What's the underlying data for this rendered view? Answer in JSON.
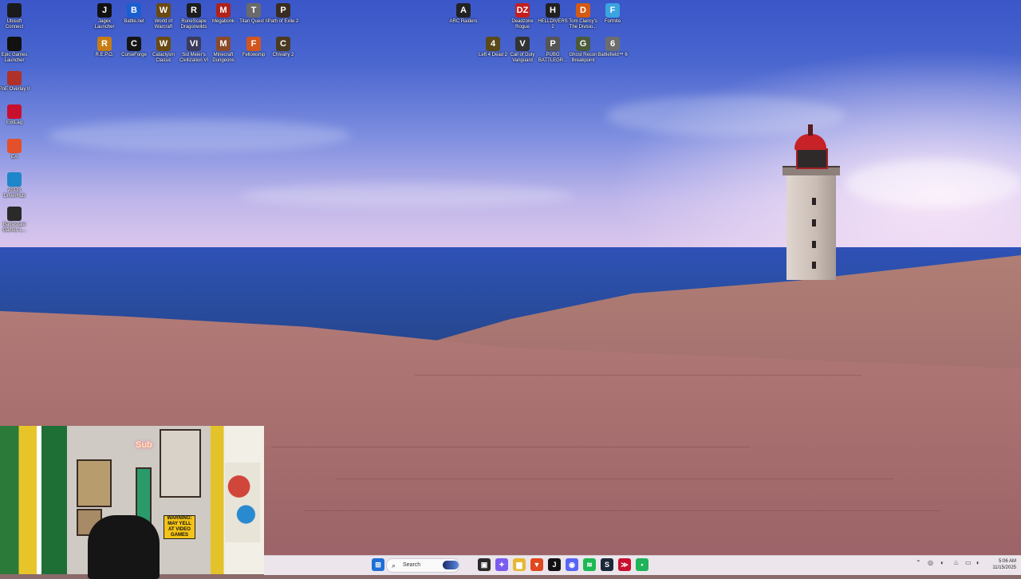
{
  "desktop": {
    "icons_left": [
      {
        "label": "Ubisoft Connect",
        "icon": "ubisoft-icon",
        "color": "#1a1a1a"
      },
      {
        "label": "Epic Games Launcher",
        "icon": "epic-icon",
        "color": "#111111"
      },
      {
        "label": "PoE Overlay II",
        "icon": "poe-overlay-icon",
        "color": "#b0302a"
      },
      {
        "label": "ExitLag",
        "icon": "exitlag-icon",
        "color": "#c8102e"
      },
      {
        "label": "EA",
        "icon": "ea-icon",
        "color": "#e4502a"
      },
      {
        "label": "ASUS DriverHub",
        "icon": "asus-icon",
        "color": "#1f86c9"
      },
      {
        "label": "Battlestate Games L...",
        "icon": "battlestate-icon",
        "color": "#2a2a2a"
      }
    ],
    "icons_row1": [
      {
        "label": "Jagex Launcher",
        "icon": "jagex-icon",
        "color": "#111111",
        "glyph": "J"
      },
      {
        "label": "Battle.net",
        "icon": "battlenet-icon",
        "color": "#1a5fd0",
        "glyph": "B"
      },
      {
        "label": "World of Warcraft",
        "icon": "wow-icon",
        "color": "#6b4a12",
        "glyph": "W"
      },
      {
        "label": "RuneScape Dragonwilds",
        "icon": "runescape-icon",
        "color": "#1c1c1c",
        "glyph": "R"
      },
      {
        "label": "Megabonk",
        "icon": "megabonk-icon",
        "color": "#b0221c",
        "glyph": "M"
      },
      {
        "label": "Titan Quest II",
        "icon": "titanquest-icon",
        "color": "#6a6a6a",
        "glyph": "T"
      },
      {
        "label": "Path of Exile 2",
        "icon": "poe2-icon",
        "color": "#3a2c22",
        "glyph": "P"
      }
    ],
    "icons_row2": [
      {
        "label": "R.E.P.O.",
        "icon": "repo-icon",
        "color": "#c77d14",
        "glyph": "R"
      },
      {
        "label": "CurseForge",
        "icon": "curseforge-icon",
        "color": "#151515",
        "glyph": "C"
      },
      {
        "label": "Cataclysm Classic",
        "icon": "cataclysm-icon",
        "color": "#6b4a12",
        "glyph": "W"
      },
      {
        "label": "Sid Meier's Civilization VI",
        "icon": "civ6-icon",
        "color": "#3b3b5c",
        "glyph": "VI"
      },
      {
        "label": "Minecraft Dungeons",
        "icon": "minecraft-icon",
        "color": "#8a4a2a",
        "glyph": "M"
      },
      {
        "label": "Fellowship",
        "icon": "fellowship-icon",
        "color": "#d3561e",
        "glyph": "F"
      },
      {
        "label": "Chivalry 2",
        "icon": "chivalry-icon",
        "color": "#4a3a20",
        "glyph": "C"
      }
    ],
    "icons_right_row1": [
      {
        "label": "ARC Raiders",
        "icon": "arc-raiders-icon",
        "color": "#222222",
        "glyph": "A"
      },
      {
        "label": "Deadzone Rogue",
        "icon": "deadzone-icon",
        "color": "#c41f1f",
        "glyph": "DZ"
      },
      {
        "label": "HELLDIVERS 2",
        "icon": "helldivers-icon",
        "color": "#202020",
        "glyph": "H"
      },
      {
        "label": "Tom Clancy's The Divisio...",
        "icon": "division-icon",
        "color": "#d45a14",
        "glyph": "D"
      },
      {
        "label": "Fortnite",
        "icon": "fortnite-icon",
        "color": "#3aa3e0",
        "glyph": "F"
      }
    ],
    "icons_right_row2": [
      {
        "label": "Left 4 Dead 2",
        "icon": "l4d2-icon",
        "color": "#5a4a1a",
        "glyph": "4"
      },
      {
        "label": "Call of Duty Vanguard",
        "icon": "cod-icon",
        "color": "#333333",
        "glyph": "V"
      },
      {
        "label": "PUBG BATTLEGR...",
        "icon": "pubg-icon",
        "color": "#555555",
        "glyph": "P"
      },
      {
        "label": "Ghost Recon Breakpoint",
        "icon": "ghostrecon-icon",
        "color": "#4a5a3a",
        "glyph": "G"
      },
      {
        "label": "Battlefield™ 6",
        "icon": "battlefield-icon",
        "color": "#6d6d6d",
        "glyph": "6"
      }
    ]
  },
  "webcam": {
    "sign_text": "WARNING: MAY YELL AT VIDEO GAMES",
    "neon_text": "Sub"
  },
  "taskbar": {
    "search_placeholder": "Search",
    "apps": [
      {
        "name": "start-button",
        "icon": "windows-icon",
        "color": "#1f6fd6",
        "glyph": "⊞"
      },
      {
        "name": "task-view-button",
        "icon": "task-view-icon",
        "color": "#2a2a2a",
        "glyph": "▣"
      },
      {
        "name": "copilot-button",
        "icon": "copilot-icon",
        "color": "#7b5cf0",
        "glyph": "✦"
      },
      {
        "name": "file-explorer-button",
        "icon": "folder-icon",
        "color": "#e8b833",
        "glyph": "▆"
      },
      {
        "name": "brave-button",
        "icon": "brave-icon",
        "color": "#e0481f",
        "glyph": "▼"
      },
      {
        "name": "jagex-button",
        "icon": "jagex-icon",
        "color": "#111111",
        "glyph": "J"
      },
      {
        "name": "discord-button",
        "icon": "discord-icon",
        "color": "#5865f2",
        "glyph": "◉"
      },
      {
        "name": "spotify-button",
        "icon": "spotify-icon",
        "color": "#1db954",
        "glyph": "≋"
      },
      {
        "name": "steam-button",
        "icon": "steam-icon",
        "color": "#1b2838",
        "glyph": "S"
      },
      {
        "name": "app-red-button",
        "icon": "exitlag-icon",
        "color": "#c8102e",
        "glyph": "≫"
      },
      {
        "name": "app-green-button",
        "icon": "chat-icon",
        "color": "#1fb35a",
        "glyph": "▪"
      }
    ],
    "clock_time": "5:06 AM",
    "clock_date": "11/15/2025"
  }
}
